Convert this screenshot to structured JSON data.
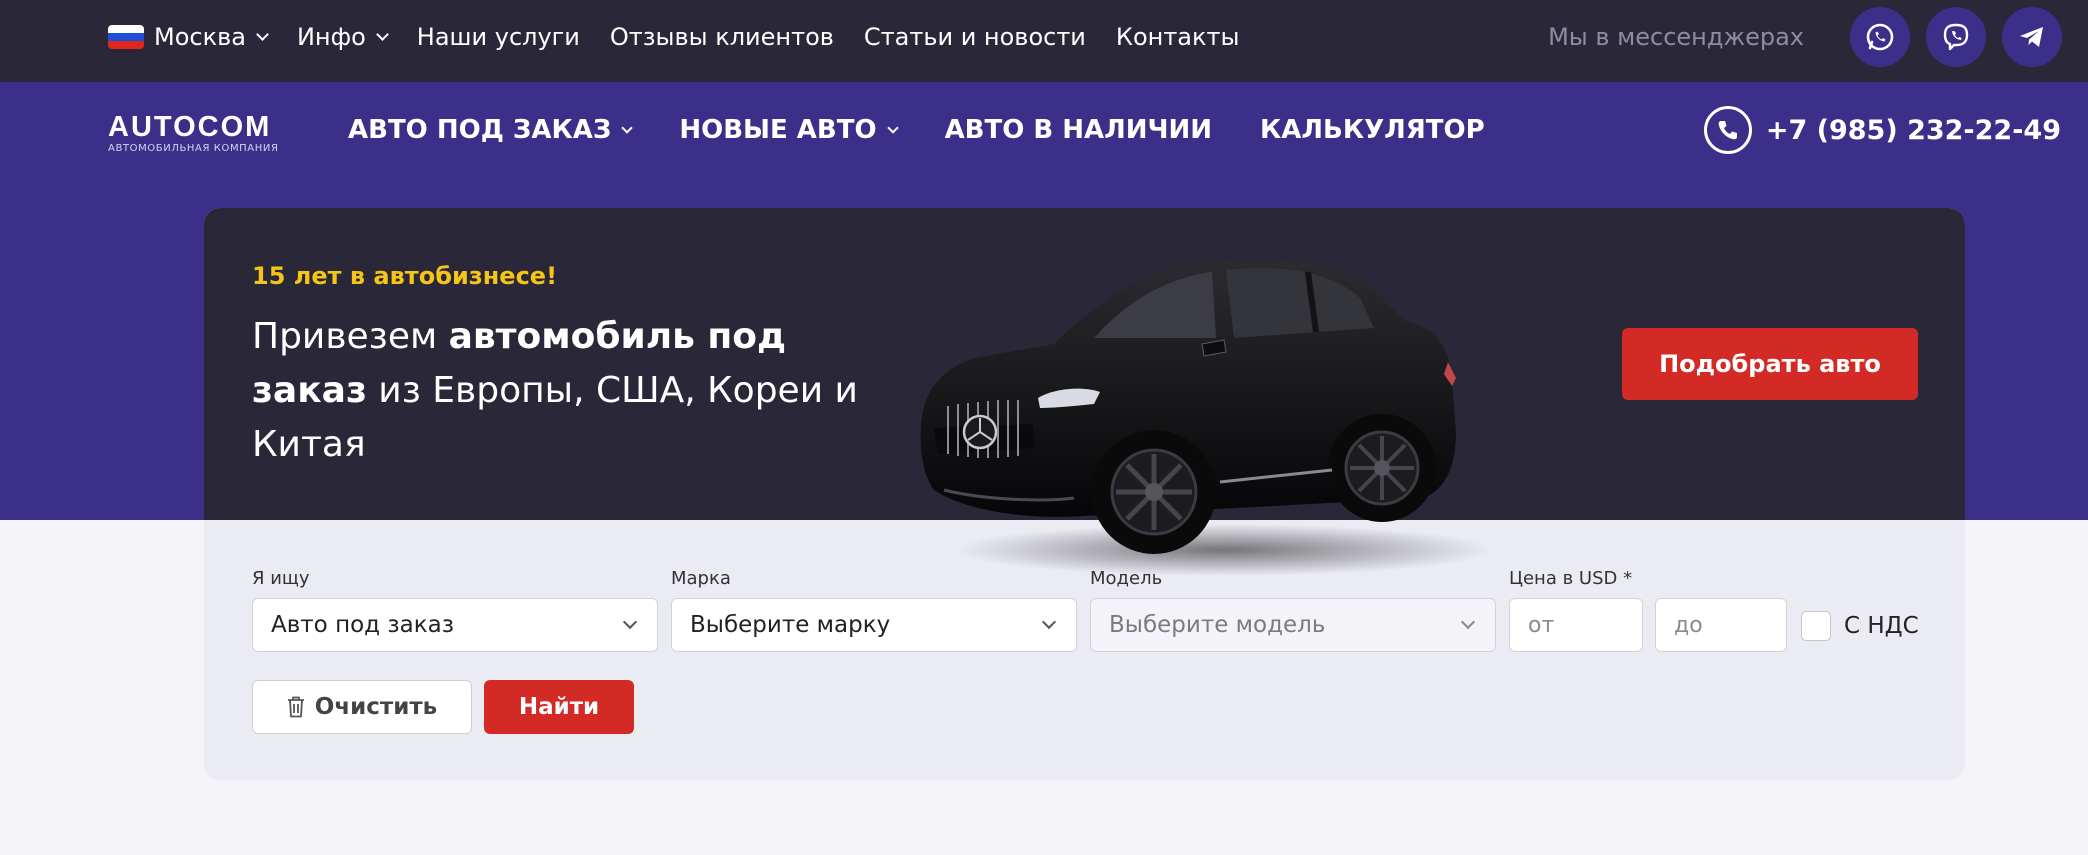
{
  "topbar": {
    "city": "Москва",
    "nav": [
      {
        "label": "Инфо",
        "dropdown": true
      },
      {
        "label": "Наши услуги",
        "dropdown": false
      },
      {
        "label": "Отзывы клиентов",
        "dropdown": false
      },
      {
        "label": "Статьи и новости",
        "dropdown": false
      },
      {
        "label": "Контакты",
        "dropdown": false
      }
    ],
    "messengers_label": "Мы в мессенджерах",
    "messengers": [
      "whatsapp-icon",
      "viber-icon",
      "telegram-icon"
    ]
  },
  "header": {
    "logo_name": "AUTOCOM",
    "logo_tagline": "АВТОМОБИЛЬНАЯ КОМПАНИЯ",
    "nav": [
      {
        "label": "АВТО ПОД ЗАКАЗ",
        "dropdown": true
      },
      {
        "label": "НОВЫЕ АВТО",
        "dropdown": true
      },
      {
        "label": "АВТО В НАЛИЧИИ",
        "dropdown": false
      },
      {
        "label": "КАЛЬКУЛЯТОР",
        "dropdown": false
      }
    ],
    "phone": "+7 (985) 232-22-49"
  },
  "hero": {
    "tagline": "15 лет в автобизнесе!",
    "headline_part1": "Привезем ",
    "headline_bold": "автомобиль под заказ",
    "headline_part2": " из Европы, США, Кореи и Китая",
    "cta_label": "Подобрать авто"
  },
  "filter": {
    "search_label": "Я ищу",
    "search_value": "Авто под заказ",
    "brand_label": "Марка",
    "brand_value": "Выберите марку",
    "model_label": "Модель",
    "model_value": "Выберите модель",
    "price_label": "Цена в USD *",
    "price_from_placeholder": "от",
    "price_to_placeholder": "до",
    "vat_label": "С НДС",
    "clear_label": "Очистить",
    "find_label": "Найти"
  },
  "colors": {
    "topbar_bg": "#2a2838",
    "brand_purple": "#3b2f8a",
    "accent_red": "#d42a26",
    "tagline_yellow": "#f5c518",
    "page_bg": "#f4f4f9"
  }
}
